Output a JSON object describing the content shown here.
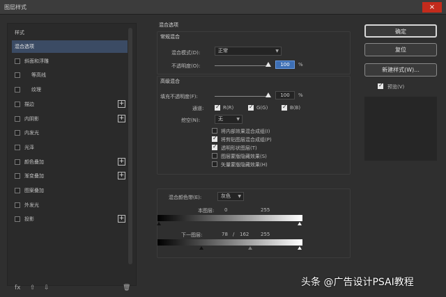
{
  "window": {
    "title": "图层样式",
    "close": "×"
  },
  "sidebar": {
    "items": [
      {
        "label": "样式",
        "checkbox": false
      },
      {
        "label": "混合选项",
        "checkbox": false,
        "selected": true
      },
      {
        "label": "斜面和浮雕",
        "checkbox": true,
        "checked": false
      },
      {
        "label": "等高线",
        "checkbox": true,
        "checked": false,
        "indent": true
      },
      {
        "label": "纹理",
        "checkbox": true,
        "checked": false,
        "indent": true
      },
      {
        "label": "描边",
        "checkbox": true,
        "checked": false,
        "plus": true
      },
      {
        "label": "内阴影",
        "checkbox": true,
        "checked": false,
        "plus": true
      },
      {
        "label": "内发光",
        "checkbox": true,
        "checked": false
      },
      {
        "label": "光泽",
        "checkbox": true,
        "checked": false
      },
      {
        "label": "颜色叠加",
        "checkbox": true,
        "checked": false,
        "plus": true
      },
      {
        "label": "渐变叠加",
        "checkbox": true,
        "checked": false,
        "plus": true
      },
      {
        "label": "图案叠加",
        "checkbox": true,
        "checked": false
      },
      {
        "label": "外发光",
        "checkbox": true,
        "checked": false
      },
      {
        "label": "投影",
        "checkbox": true,
        "checked": false,
        "plus": true
      }
    ],
    "footer": {
      "fx": "fx",
      "up": "⇧",
      "down": "⇩",
      "trash": "🗑"
    }
  },
  "blend": {
    "section_title": "混合选项",
    "general_title": "常规混合",
    "mode_label": "混合模式(D):",
    "mode_value": "正常",
    "opacity_label": "不透明度(O):",
    "opacity_value": "100",
    "percent": "%",
    "advanced_title": "高级混合",
    "fill_label": "填充不透明度(F):",
    "fill_value": "100",
    "channels_label": "通道:",
    "channel_r": "R(R)",
    "channel_g": "G(G)",
    "channel_b": "B(B)",
    "knockout_label": "挖空(N):",
    "knockout_value": "无",
    "options": [
      {
        "label": "将内部效果混合成组(I)",
        "checked": false
      },
      {
        "label": "将剪贴图层混合成组(P)",
        "checked": true
      },
      {
        "label": "透明形状图层(T)",
        "checked": true
      },
      {
        "label": "图层蒙版隐藏效果(S)",
        "checked": false
      },
      {
        "label": "矢量蒙版隐藏效果(H)",
        "checked": false
      }
    ],
    "blendif_label": "混合颜色带(E):",
    "blendif_value": "灰色",
    "this_layer_label": "本图层:",
    "this_layer_low": "0",
    "this_layer_high": "255",
    "underlying_label": "下一图层:",
    "underlying_low": "78",
    "underlying_sep": "/",
    "underlying_mid": "162",
    "underlying_high": "255"
  },
  "buttons": {
    "ok": "确定",
    "reset": "复位",
    "new_style": "新建样式(W)...",
    "preview_label": "预览(V)",
    "preview_checked": true
  },
  "watermark": "头条 @广告设计PSAI教程"
}
